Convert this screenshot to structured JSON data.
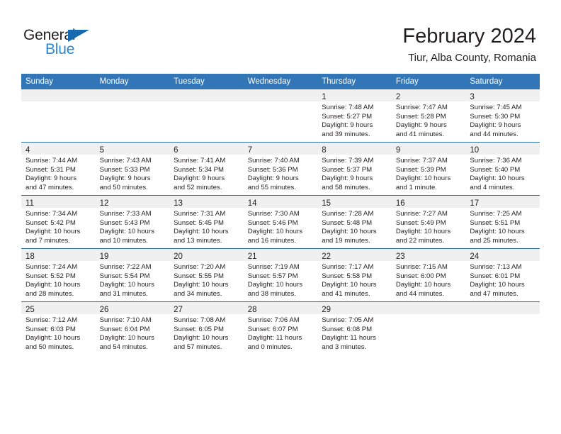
{
  "brand": {
    "name_part1": "General",
    "name_part2": "Blue",
    "flag_icon": "blue-triangle-flag-icon",
    "color_dark": "#231f20",
    "color_blue": "#2b87d3"
  },
  "header": {
    "month_title": "February 2024",
    "location": "Tiur, Alba County, Romania"
  },
  "theme": {
    "header_row_bg": "#3276b8",
    "row_divider": "#2e6ca4",
    "daynum_band_bg": "#f0f0f0",
    "text": "#231f20"
  },
  "weekdays": [
    "Sunday",
    "Monday",
    "Tuesday",
    "Wednesday",
    "Thursday",
    "Friday",
    "Saturday"
  ],
  "weeks": [
    [
      {
        "empty": true
      },
      {
        "empty": true
      },
      {
        "empty": true
      },
      {
        "empty": true
      },
      {
        "empty": false,
        "day": "1",
        "sunrise": "Sunrise: 7:48 AM",
        "sunset": "Sunset: 5:27 PM",
        "daylight_line1": "Daylight: 9 hours",
        "daylight_line2": "and 39 minutes."
      },
      {
        "empty": false,
        "day": "2",
        "sunrise": "Sunrise: 7:47 AM",
        "sunset": "Sunset: 5:28 PM",
        "daylight_line1": "Daylight: 9 hours",
        "daylight_line2": "and 41 minutes."
      },
      {
        "empty": false,
        "day": "3",
        "sunrise": "Sunrise: 7:45 AM",
        "sunset": "Sunset: 5:30 PM",
        "daylight_line1": "Daylight: 9 hours",
        "daylight_line2": "and 44 minutes."
      }
    ],
    [
      {
        "empty": false,
        "day": "4",
        "sunrise": "Sunrise: 7:44 AM",
        "sunset": "Sunset: 5:31 PM",
        "daylight_line1": "Daylight: 9 hours",
        "daylight_line2": "and 47 minutes."
      },
      {
        "empty": false,
        "day": "5",
        "sunrise": "Sunrise: 7:43 AM",
        "sunset": "Sunset: 5:33 PM",
        "daylight_line1": "Daylight: 9 hours",
        "daylight_line2": "and 50 minutes."
      },
      {
        "empty": false,
        "day": "6",
        "sunrise": "Sunrise: 7:41 AM",
        "sunset": "Sunset: 5:34 PM",
        "daylight_line1": "Daylight: 9 hours",
        "daylight_line2": "and 52 minutes."
      },
      {
        "empty": false,
        "day": "7",
        "sunrise": "Sunrise: 7:40 AM",
        "sunset": "Sunset: 5:36 PM",
        "daylight_line1": "Daylight: 9 hours",
        "daylight_line2": "and 55 minutes."
      },
      {
        "empty": false,
        "day": "8",
        "sunrise": "Sunrise: 7:39 AM",
        "sunset": "Sunset: 5:37 PM",
        "daylight_line1": "Daylight: 9 hours",
        "daylight_line2": "and 58 minutes."
      },
      {
        "empty": false,
        "day": "9",
        "sunrise": "Sunrise: 7:37 AM",
        "sunset": "Sunset: 5:39 PM",
        "daylight_line1": "Daylight: 10 hours",
        "daylight_line2": "and 1 minute."
      },
      {
        "empty": false,
        "day": "10",
        "sunrise": "Sunrise: 7:36 AM",
        "sunset": "Sunset: 5:40 PM",
        "daylight_line1": "Daylight: 10 hours",
        "daylight_line2": "and 4 minutes."
      }
    ],
    [
      {
        "empty": false,
        "day": "11",
        "sunrise": "Sunrise: 7:34 AM",
        "sunset": "Sunset: 5:42 PM",
        "daylight_line1": "Daylight: 10 hours",
        "daylight_line2": "and 7 minutes."
      },
      {
        "empty": false,
        "day": "12",
        "sunrise": "Sunrise: 7:33 AM",
        "sunset": "Sunset: 5:43 PM",
        "daylight_line1": "Daylight: 10 hours",
        "daylight_line2": "and 10 minutes."
      },
      {
        "empty": false,
        "day": "13",
        "sunrise": "Sunrise: 7:31 AM",
        "sunset": "Sunset: 5:45 PM",
        "daylight_line1": "Daylight: 10 hours",
        "daylight_line2": "and 13 minutes."
      },
      {
        "empty": false,
        "day": "14",
        "sunrise": "Sunrise: 7:30 AM",
        "sunset": "Sunset: 5:46 PM",
        "daylight_line1": "Daylight: 10 hours",
        "daylight_line2": "and 16 minutes."
      },
      {
        "empty": false,
        "day": "15",
        "sunrise": "Sunrise: 7:28 AM",
        "sunset": "Sunset: 5:48 PM",
        "daylight_line1": "Daylight: 10 hours",
        "daylight_line2": "and 19 minutes."
      },
      {
        "empty": false,
        "day": "16",
        "sunrise": "Sunrise: 7:27 AM",
        "sunset": "Sunset: 5:49 PM",
        "daylight_line1": "Daylight: 10 hours",
        "daylight_line2": "and 22 minutes."
      },
      {
        "empty": false,
        "day": "17",
        "sunrise": "Sunrise: 7:25 AM",
        "sunset": "Sunset: 5:51 PM",
        "daylight_line1": "Daylight: 10 hours",
        "daylight_line2": "and 25 minutes."
      }
    ],
    [
      {
        "empty": false,
        "day": "18",
        "sunrise": "Sunrise: 7:24 AM",
        "sunset": "Sunset: 5:52 PM",
        "daylight_line1": "Daylight: 10 hours",
        "daylight_line2": "and 28 minutes."
      },
      {
        "empty": false,
        "day": "19",
        "sunrise": "Sunrise: 7:22 AM",
        "sunset": "Sunset: 5:54 PM",
        "daylight_line1": "Daylight: 10 hours",
        "daylight_line2": "and 31 minutes."
      },
      {
        "empty": false,
        "day": "20",
        "sunrise": "Sunrise: 7:20 AM",
        "sunset": "Sunset: 5:55 PM",
        "daylight_line1": "Daylight: 10 hours",
        "daylight_line2": "and 34 minutes."
      },
      {
        "empty": false,
        "day": "21",
        "sunrise": "Sunrise: 7:19 AM",
        "sunset": "Sunset: 5:57 PM",
        "daylight_line1": "Daylight: 10 hours",
        "daylight_line2": "and 38 minutes."
      },
      {
        "empty": false,
        "day": "22",
        "sunrise": "Sunrise: 7:17 AM",
        "sunset": "Sunset: 5:58 PM",
        "daylight_line1": "Daylight: 10 hours",
        "daylight_line2": "and 41 minutes."
      },
      {
        "empty": false,
        "day": "23",
        "sunrise": "Sunrise: 7:15 AM",
        "sunset": "Sunset: 6:00 PM",
        "daylight_line1": "Daylight: 10 hours",
        "daylight_line2": "and 44 minutes."
      },
      {
        "empty": false,
        "day": "24",
        "sunrise": "Sunrise: 7:13 AM",
        "sunset": "Sunset: 6:01 PM",
        "daylight_line1": "Daylight: 10 hours",
        "daylight_line2": "and 47 minutes."
      }
    ],
    [
      {
        "empty": false,
        "day": "25",
        "sunrise": "Sunrise: 7:12 AM",
        "sunset": "Sunset: 6:03 PM",
        "daylight_line1": "Daylight: 10 hours",
        "daylight_line2": "and 50 minutes."
      },
      {
        "empty": false,
        "day": "26",
        "sunrise": "Sunrise: 7:10 AM",
        "sunset": "Sunset: 6:04 PM",
        "daylight_line1": "Daylight: 10 hours",
        "daylight_line2": "and 54 minutes."
      },
      {
        "empty": false,
        "day": "27",
        "sunrise": "Sunrise: 7:08 AM",
        "sunset": "Sunset: 6:05 PM",
        "daylight_line1": "Daylight: 10 hours",
        "daylight_line2": "and 57 minutes."
      },
      {
        "empty": false,
        "day": "28",
        "sunrise": "Sunrise: 7:06 AM",
        "sunset": "Sunset: 6:07 PM",
        "daylight_line1": "Daylight: 11 hours",
        "daylight_line2": "and 0 minutes."
      },
      {
        "empty": false,
        "day": "29",
        "sunrise": "Sunrise: 7:05 AM",
        "sunset": "Sunset: 6:08 PM",
        "daylight_line1": "Daylight: 11 hours",
        "daylight_line2": "and 3 minutes."
      },
      {
        "empty": true
      },
      {
        "empty": true
      }
    ]
  ]
}
